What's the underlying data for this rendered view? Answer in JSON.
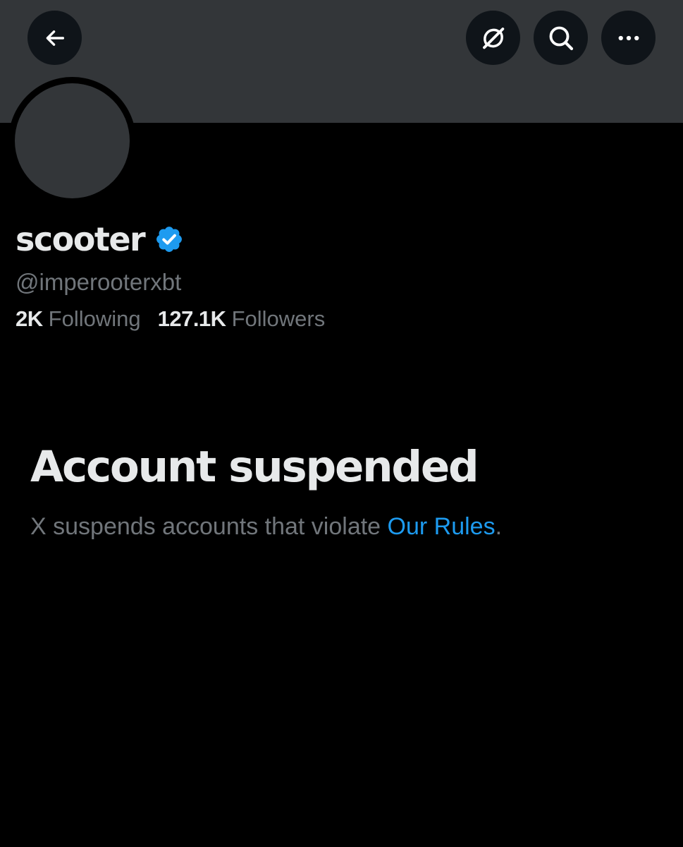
{
  "header": {
    "back_icon": "arrow-left-icon",
    "grok_icon": "grok-slash-icon",
    "search_icon": "search-icon",
    "more_icon": "more-dots-icon",
    "banner_color": "#333639",
    "button_bg": "#0f1419"
  },
  "profile": {
    "display_name": "scooter",
    "verified": true,
    "verified_badge_icon": "verified-badge-icon",
    "verified_color": "#1d9bf0",
    "handle": "@imperooterxbt",
    "following_count": "2K",
    "following_label": "Following",
    "followers_count": "127.1K",
    "followers_label": "Followers"
  },
  "suspension": {
    "title": "Account suspended",
    "message_prefix": "X suspends accounts that violate ",
    "link_text": "Our Rules",
    "message_suffix": ".",
    "link_color": "#1d9bf0"
  },
  "colors": {
    "background": "#000000",
    "primary_text": "#e7e9ea",
    "secondary_text": "#71767b"
  }
}
